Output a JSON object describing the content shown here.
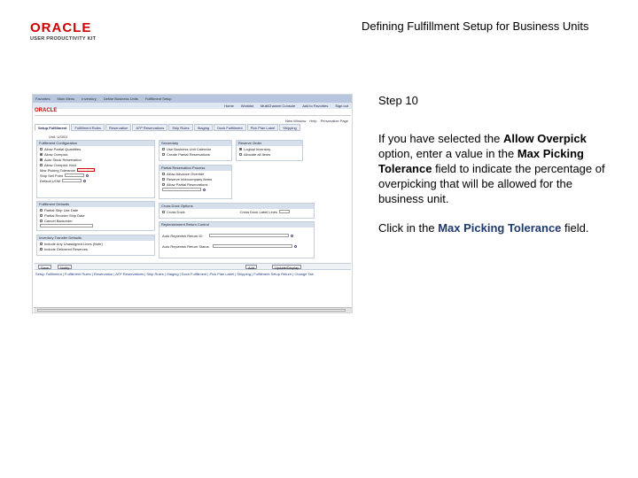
{
  "header": {
    "logo_text": "ORACLE",
    "logo_sub": "USER PRODUCTIVITY KIT",
    "slide_title": "Defining Fulfillment Setup for Business Units"
  },
  "instructions": {
    "step": "Step 10",
    "p1_a": "If you have selected the ",
    "p1_b": "Allow Overpick",
    "p1_c": " option, enter a value in the ",
    "p1_d": "Max Picking Tolerance",
    "p1_e": " field to indicate the percentage of overpicking that will be allowed for the business unit.",
    "p2_a": "Click in the ",
    "p2_b": "Max Picking Tolerance",
    "p2_c": " field."
  },
  "app": {
    "nav_items": [
      "Favorites",
      "Main Menu",
      "Inventory",
      "Define Business Units",
      "Fulfillment Setup"
    ],
    "nav_right": [
      "Home",
      "Worklist",
      "MultiChannel Console",
      "Add to Favorites",
      "Sign out"
    ],
    "brand": "ORACLE",
    "top_links": [
      "New Window",
      "Help",
      "Personalize Page"
    ],
    "tabs": [
      "Setup Fulfillment",
      "Fulfillment Rules",
      "Reservation",
      "ATP Reservations",
      "Ship Rules",
      "Staging",
      "Dock Fulfillment",
      "Pick Plan Label",
      "Shipping"
    ],
    "unit_label": "Unit: US001",
    "sections": {
      "fulfill_config": "Fulfillment Configuration",
      "fc_rows": [
        "Allow Partial Quantities",
        "Allow Overpick",
        "Auto Stock Reservation",
        "Allow Overpick Hold",
        "Max Picking Tolerance",
        "Ship Sell Point",
        "Default UOM"
      ],
      "secondary": "Secondary",
      "sec_rows": [
        "Use Business Unit Calendar",
        "Create Partial Reservations"
      ],
      "reserve_order": "Reserve Order",
      "ro_rows": [
        "Logical Inventory",
        "Allocate all Items"
      ],
      "partial_res": "Partial Reservation Process",
      "pr_rows": [
        "Allow Advance Override",
        "Reserve Intercompany Items",
        "Allow Partial Reservations"
      ],
      "auto_defaults": "Fulfillment Defaults",
      "ad_rows": [
        "Partial Ship Use Date",
        "Partial Reorder Ship Date",
        "Cancel Backorder"
      ],
      "cross_dock": "Cross Dock Options",
      "cd_rows": [
        "Cross Dock",
        "Cross Dock Label Lines"
      ],
      "replenish": "Replenishment Return Control",
      "rp_rows": [
        "Auto Replenish Return ID",
        "Auto Replenish Return Status"
      ],
      "transfer": "Inventory Transfer Defaults",
      "tr_rows": [
        "Include Any Unassigned Lines (Note)",
        "Include Delivered Reserves"
      ]
    },
    "buttons": [
      "Save",
      "Notify",
      "Add",
      "Update/Display"
    ],
    "bottom_links": "Setup Fulfillment | Fulfillment Rules | Reservation | ATP Reservations | Ship Rules | Staging | Dock Fulfillment | Pick Plan Label | Shipping | Fulfillment Setup Return | Change Tab"
  }
}
